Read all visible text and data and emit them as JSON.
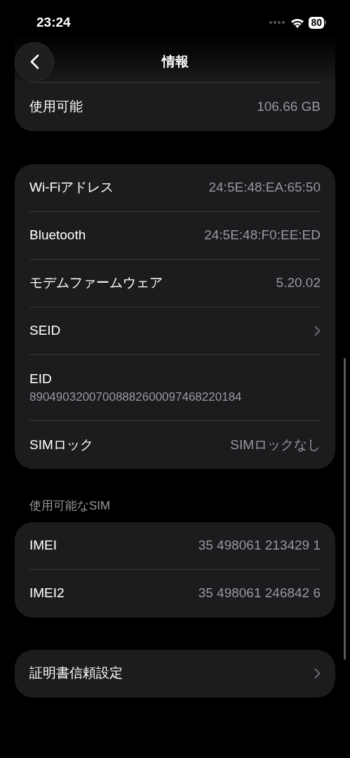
{
  "status_bar": {
    "time": "23:24",
    "battery": "80"
  },
  "header": {
    "title": "情報"
  },
  "storage_rows": [
    {
      "label": "使用可能",
      "value": "106.66 GB"
    }
  ],
  "network_rows": [
    {
      "kind": "value",
      "label": "Wi-Fiアドレス",
      "value": "24:5E:48:EA:65:50"
    },
    {
      "kind": "value",
      "label": "Bluetooth",
      "value": "24:5E:48:F0:EE:ED"
    },
    {
      "kind": "value",
      "label": "モデムファームウェア",
      "value": "5.20.02"
    },
    {
      "kind": "link",
      "label": "SEID"
    },
    {
      "kind": "stacked",
      "label": "EID",
      "value": "89049032007008882600097468220184"
    },
    {
      "kind": "value",
      "label": "SIMロック",
      "value": "SIMロックなし"
    }
  ],
  "sim_section": {
    "title": "使用可能なSIM",
    "rows": [
      {
        "kind": "value",
        "label": "IMEI",
        "value": "35 498061 213429 1"
      },
      {
        "kind": "value",
        "label": "IMEI2",
        "value": "35 498061 246842 6"
      }
    ]
  },
  "trust_rows": [
    {
      "kind": "link",
      "label": "証明書信頼設定"
    }
  ]
}
